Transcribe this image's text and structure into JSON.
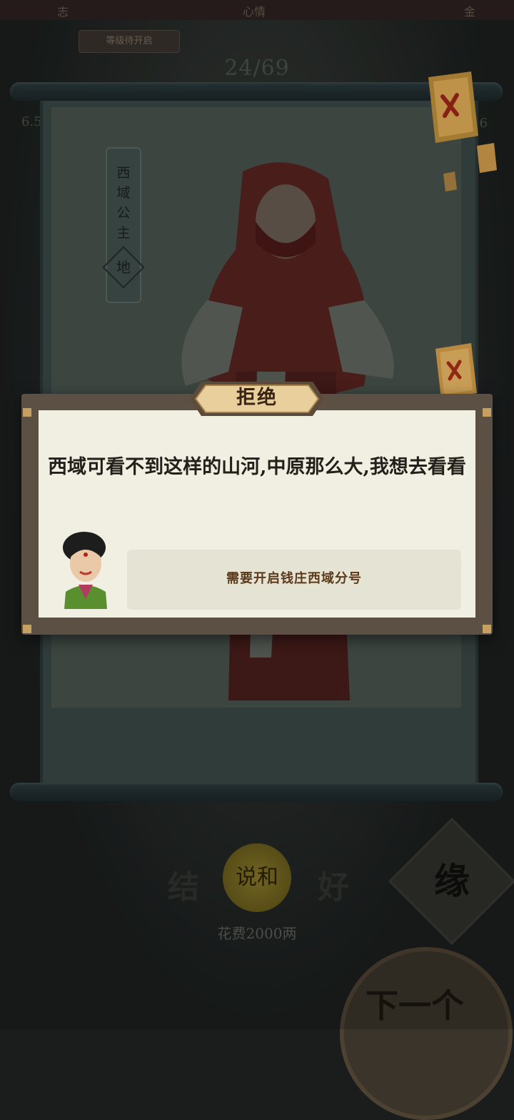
{
  "top_bar": {
    "left": "志",
    "center": "心情",
    "right": "金"
  },
  "sub_bar_text": "等级待开启",
  "progress_text": "24/69",
  "side_values": {
    "left": "6.5",
    "right": "96"
  },
  "character": {
    "name": "西域公主",
    "grade": "地"
  },
  "dialog": {
    "title": "拒绝",
    "message": "西域可看不到这样的山河,中原那么大,我想去看看",
    "requirement": "需要开启钱庄西域分号"
  },
  "controls": {
    "mediate_label": "说和",
    "cost_label": "花费2000两",
    "yuan_label": "缘",
    "next_label": "下一个",
    "ghost_left": "结",
    "ghost_right": "好"
  },
  "colors": {
    "dialog_frame": "#5c4f44",
    "paper": "#f0efe1",
    "title_plaque": "#e8cf9c",
    "requirement_text": "#5b3a1a",
    "lantern": "#f4c06a"
  }
}
